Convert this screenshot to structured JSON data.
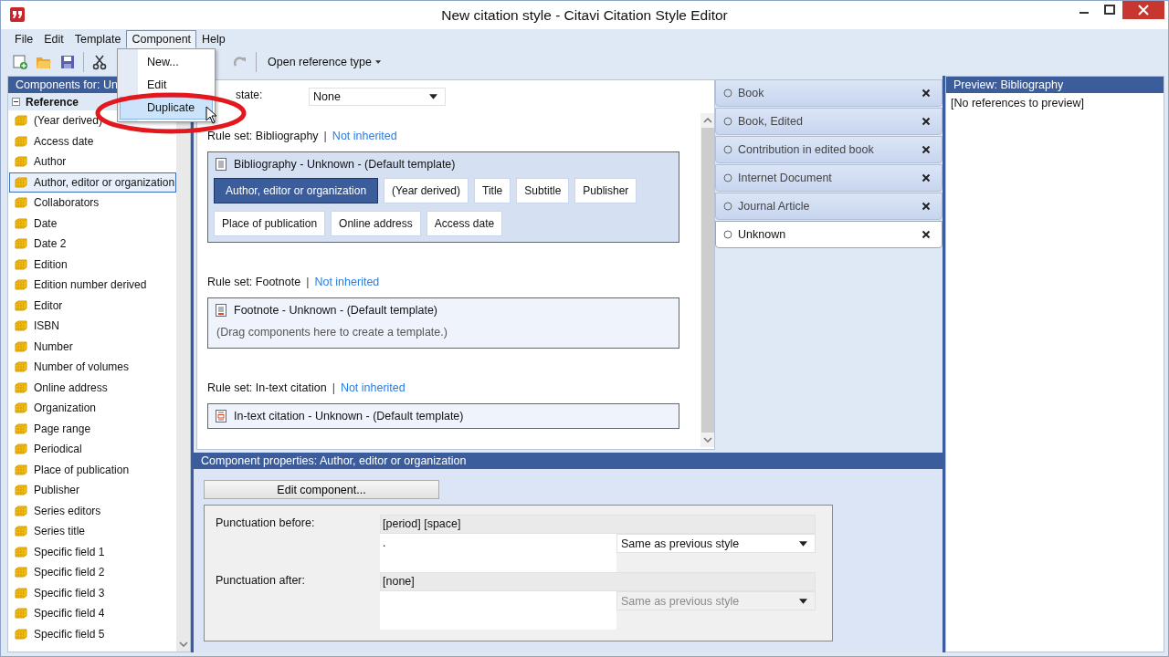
{
  "window": {
    "title": "New citation style - Citavi Citation Style Editor"
  },
  "menu": [
    {
      "label": "File",
      "selected": false
    },
    {
      "label": "Edit",
      "selected": false
    },
    {
      "label": "Template",
      "selected": false
    },
    {
      "label": "Component",
      "selected": true
    },
    {
      "label": "Help",
      "selected": false
    }
  ],
  "component_menu": [
    {
      "label": "New...",
      "selected": false
    },
    {
      "label": "Edit",
      "selected": false
    },
    {
      "label": "Duplicate",
      "selected": true
    }
  ],
  "toolbar": {
    "open_reference_type": "Open reference type"
  },
  "left_panel": {
    "header": "Components for: Un",
    "group": {
      "label": "Reference",
      "expanded": true
    },
    "items": [
      {
        "label": "(Year derived)",
        "selected": false
      },
      {
        "label": "Access date",
        "selected": false
      },
      {
        "label": "Author",
        "selected": false
      },
      {
        "label": "Author, editor or organization",
        "selected": true
      },
      {
        "label": "Collaborators",
        "selected": false
      },
      {
        "label": "Date",
        "selected": false
      },
      {
        "label": "Date 2",
        "selected": false
      },
      {
        "label": "Edition",
        "selected": false
      },
      {
        "label": "Edition number derived",
        "selected": false
      },
      {
        "label": "Editor",
        "selected": false
      },
      {
        "label": "ISBN",
        "selected": false
      },
      {
        "label": "Number",
        "selected": false
      },
      {
        "label": "Number of volumes",
        "selected": false
      },
      {
        "label": "Online address",
        "selected": false
      },
      {
        "label": "Organization",
        "selected": false
      },
      {
        "label": "Page range",
        "selected": false
      },
      {
        "label": "Periodical",
        "selected": false
      },
      {
        "label": "Place of publication",
        "selected": false
      },
      {
        "label": "Publisher",
        "selected": false
      },
      {
        "label": "Series editors",
        "selected": false
      },
      {
        "label": "Series title",
        "selected": false
      },
      {
        "label": "Specific field 1",
        "selected": false
      },
      {
        "label": "Specific field 2",
        "selected": false
      },
      {
        "label": "Specific field 3",
        "selected": false
      },
      {
        "label": "Specific field 4",
        "selected": false
      },
      {
        "label": "Specific field 5",
        "selected": false
      }
    ]
  },
  "editor": {
    "edit_state": {
      "label": "state:",
      "value": "None"
    },
    "rule_sets": [
      {
        "title": "Rule set: Bibliography",
        "separator": "|",
        "link": "Not inherited",
        "template": {
          "kind": "bibliography",
          "title": "Bibliography - Unknown - (Default template)",
          "components": [
            {
              "label": "Author, editor or organization",
              "selected": true
            },
            {
              "label": "(Year derived)",
              "selected": false
            },
            {
              "label": "Title",
              "selected": false
            },
            {
              "label": "Subtitle",
              "selected": false
            },
            {
              "label": "Publisher",
              "selected": false
            },
            {
              "label": "Place of publication",
              "selected": false
            },
            {
              "label": "Online address",
              "selected": false
            },
            {
              "label": "Access date",
              "selected": false
            }
          ]
        }
      },
      {
        "title": "Rule set: Footnote",
        "separator": "|",
        "link": "Not inherited",
        "template": {
          "kind": "footnote",
          "title": "Footnote - Unknown - (Default template)",
          "hint": "(Drag components here to create a template.)"
        }
      },
      {
        "title": "Rule set: In-text citation",
        "separator": "|",
        "link": "Not inherited",
        "template": {
          "kind": "citation",
          "title": "In-text citation - Unknown - (Default template)"
        }
      }
    ]
  },
  "reference_types": [
    {
      "label": "Book",
      "selected": false
    },
    {
      "label": "Book, Edited",
      "selected": false
    },
    {
      "label": "Contribution in edited book",
      "selected": false
    },
    {
      "label": "Internet Document",
      "selected": false
    },
    {
      "label": "Journal Article",
      "selected": false
    },
    {
      "label": "Unknown",
      "selected": true
    }
  ],
  "preview": {
    "header": "Preview: Bibliography",
    "text": "[No references to preview]"
  },
  "properties": {
    "header": "Component properties:  Author, editor or organization",
    "button": "Edit component...",
    "rows": [
      {
        "label": "Punctuation before:",
        "summary": "[period] [space]",
        "value": ".",
        "style": "Same as previous style",
        "disabled": false
      },
      {
        "label": "Punctuation after:",
        "summary": "[none]",
        "style": "Same as previous style",
        "disabled": true
      }
    ]
  }
}
